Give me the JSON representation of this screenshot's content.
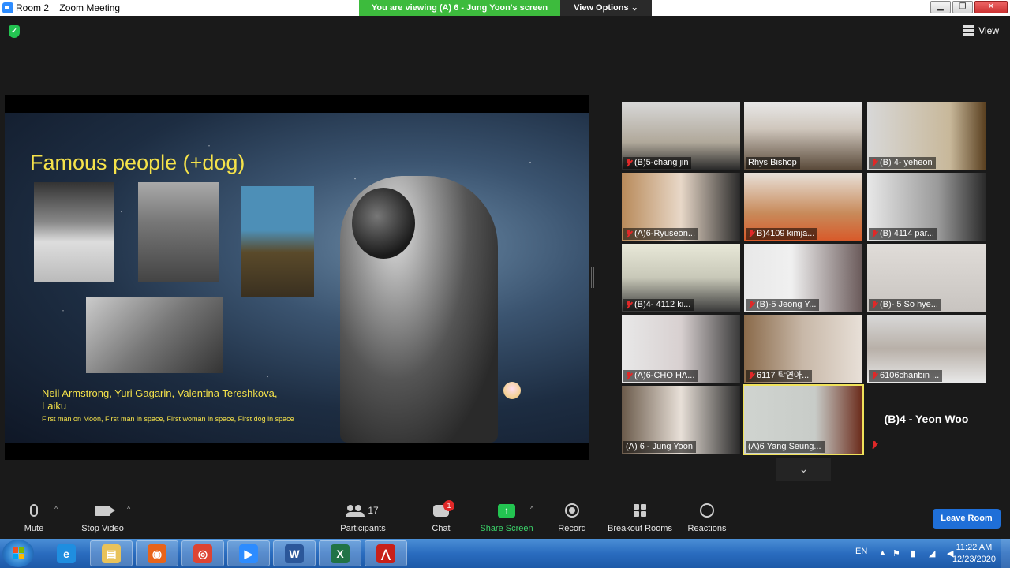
{
  "window": {
    "room_label": "Room 2",
    "app_title": "Zoom Meeting",
    "viewing_banner": "You are viewing (A) 6 - Jung Yoon's screen",
    "view_options_label": "View Options ⌄",
    "view_label": "View"
  },
  "slide": {
    "title": "Famous people (+dog)",
    "names": "Neil Armstrong, Yuri Gagarin, Valentina Tereshkova, Laiku",
    "caption": "First man on Moon, First man in space, First woman in space, First dog in space"
  },
  "participants": [
    {
      "name": "(B)5-chang jin",
      "muted": true,
      "bg": "linear-gradient(#d8d8d8,#b0a89a 60%,#2a2a2a)"
    },
    {
      "name": "Rhys Bishop",
      "muted": false,
      "bg": "linear-gradient(#e8e8e8,#cfc6bc 40%,#5a4a3a)"
    },
    {
      "name": "(B) 4-  yeheon",
      "muted": true,
      "bg": "linear-gradient(90deg,#d8d8d8,#c8b89a 70%,#5a4020)"
    },
    {
      "name": "(A)6-Ryuseon...",
      "muted": true,
      "bg": "linear-gradient(90deg,#b88a5a,#e8d8c8 50%,#2a2a2a)"
    },
    {
      "name": "B)4109 kimja...",
      "muted": true,
      "bg": "linear-gradient(#e8e0d8,#c88a5a 60%,#d85a2a)"
    },
    {
      "name": "(B) 4114  par...",
      "muted": true,
      "bg": "linear-gradient(90deg,#e8e8e8,#9a9a9a 60%,#2a2a2a)"
    },
    {
      "name": "(B)4- 4112 ki...",
      "muted": true,
      "bg": "linear-gradient(#e8e8d8,#c8c8b8 50%,#3a3a3a)"
    },
    {
      "name": "(B)-5 Jeong Y...",
      "muted": true,
      "bg": "linear-gradient(90deg,#e8e8e8,#f0f0f0 40%,#6a5a5a)"
    },
    {
      "name": "(B)- 5 So hye...",
      "muted": true,
      "bg": "linear-gradient(#e0dcd8,#c8c4c0)"
    },
    {
      "name": "(A)6-CHO HA...",
      "muted": true,
      "bg": "linear-gradient(90deg,#e8e8e8,#d8d0d0 50%,#3a3a3a)"
    },
    {
      "name": "6117 탁연아...",
      "muted": true,
      "bg": "linear-gradient(90deg,#8a6a4a,#c8b8a8 50%,#e8e0d8)"
    },
    {
      "name": "6106chanbin ...",
      "muted": true,
      "bg": "linear-gradient(#d8d8d8,#b8b0a8 50%,#e8e8e8)"
    },
    {
      "name": "(A) 6 - Jung Yoon",
      "muted": false,
      "bg": "linear-gradient(90deg,#6a5a4a,#e8e0d8 50%,#2a2a2a)"
    },
    {
      "name": "(A)6 Yang Seung...",
      "muted": false,
      "bg": "linear-gradient(90deg,#d0d4d0,#c8ccc8 60%,#6a2a1a)"
    }
  ],
  "no_video_participant": {
    "name": "(B)4 - Yeon Woo",
    "muted": true
  },
  "toolbar": {
    "mute": "Mute",
    "stop_video": "Stop Video",
    "participants": "Participants",
    "participant_count": "17",
    "chat": "Chat",
    "chat_badge": "1",
    "share_screen": "Share Screen",
    "record": "Record",
    "breakout_rooms": "Breakout Rooms",
    "reactions": "Reactions",
    "leave": "Leave Room"
  },
  "taskbar": {
    "apps": [
      {
        "name": "internet-explorer",
        "glyph": "e",
        "color": "#1f8ee0",
        "open": false
      },
      {
        "name": "file-explorer",
        "glyph": "▤",
        "color": "#e8c25a",
        "open": true
      },
      {
        "name": "firefox",
        "glyph": "◉",
        "color": "#e8641a",
        "open": true
      },
      {
        "name": "chrome",
        "glyph": "◎",
        "color": "#dd4433",
        "open": true
      },
      {
        "name": "zoom",
        "glyph": "▶",
        "color": "#2d8cff",
        "open": true
      },
      {
        "name": "word",
        "glyph": "W",
        "color": "#2b579a",
        "open": true
      },
      {
        "name": "excel",
        "glyph": "X",
        "color": "#217346",
        "open": true
      },
      {
        "name": "acrobat",
        "glyph": "⋀",
        "color": "#c8201a",
        "open": true
      }
    ],
    "lang": "EN",
    "time": "11:22 AM",
    "date": "12/23/2020"
  }
}
